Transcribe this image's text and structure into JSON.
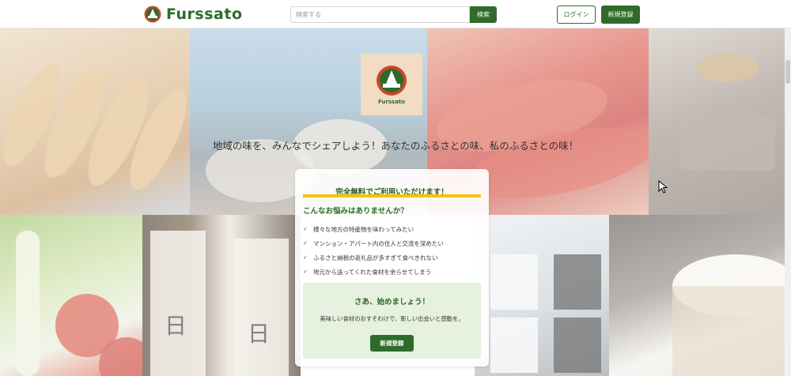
{
  "header": {
    "logo_text": "Furssato",
    "search_placeholder": "検索する",
    "search_button": "検索",
    "login_button": "ログイン",
    "signup_button": "新規登録"
  },
  "hero": {
    "logo_caption": "Furssato",
    "tagline": "地域の味を、みんなでシェアしよう！あなたのふるさとの味、私のふるさとの味！"
  },
  "card": {
    "free_title": "完全無料でご利用いただけます！",
    "worry_title": "こんなお悩みはありませんか？",
    "worries": [
      "様々な地方の特産物を味わってみたい",
      "マンション・アパート内の住人と交流を深めたい",
      "ふるさと納税の返礼品が多すぎて食べきれない",
      "地元から送ってくれた食材を余らせてしまう"
    ],
    "cta_title": "さあ、始めましょう！",
    "cta_desc": "美味しい食材のおすそわけで、新しい出会いと感動を。",
    "cta_button": "新規登録"
  },
  "colors": {
    "brand_green": "#2f6b2b",
    "highlight_yellow": "#f1c40f",
    "cta_background": "#e6f1df",
    "logo_background": "#f2dcc3"
  }
}
